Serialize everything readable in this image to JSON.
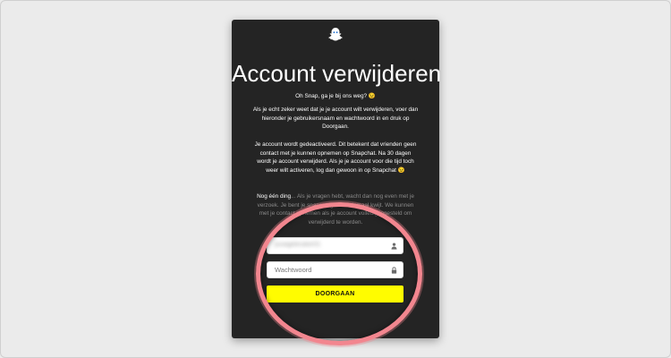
{
  "page": {
    "title": "Account verwijderen",
    "intro": "Oh Snap, ga je bij ons weg? 😉",
    "paragraph1": "Als je echt zeker weet dat je je account wilt verwijderen, voer dan hieronder je gebruikersnaam en wachtwoord in en druk op Doorgaan.",
    "paragraph2": "Je account wordt gedeactiveerd. Dit betekent dat vrienden geen contact met je kunnen opnemen op Snapchat. Na 30 dagen wordt je account verwijderd. Als je je account voor die tijd toch weer wilt activeren, log dan gewoon in op Snapchat 😉",
    "paragraph3_visible": "Nog één ding",
    "paragraph3_dim": "... Als je vragen hebt, wacht dan nog even met je verzoek. Je bent je snaps nog niet helemaal kwijt. We kunnen met je contact opnemen als je account volledig ingesteld om verwijderd te worden."
  },
  "form": {
    "username_value": "jouwgebruiker01",
    "password_placeholder": "Wachtwoord",
    "submit_label": "DOORGAAN"
  },
  "icons": {
    "logo": "snapchat-ghost-icon",
    "username": "user-icon",
    "password": "lock-icon"
  },
  "colors": {
    "card_background": "#242424",
    "button": "#fffc00",
    "highlight_ring": "#f2868f"
  }
}
